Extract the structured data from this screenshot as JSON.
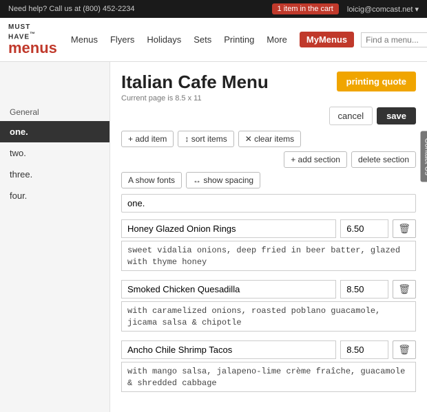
{
  "topbar": {
    "help_text": "Need help? Call us at (800) 452-2234",
    "cart_label": "1 item in the cart",
    "user_email": "loicig@comcast.net ▾"
  },
  "nav": {
    "logo_must_have": "MUST HAVE",
    "logo_tm": "™",
    "logo_menus": "menus",
    "links": [
      "Menus",
      "Flyers",
      "Holidays",
      "Sets",
      "Printing",
      "More"
    ],
    "my_menus": "MyMenus",
    "search_placeholder": "Find a menu..."
  },
  "page": {
    "title": "Italian Cafe Menu",
    "subtitle": "Current page is 8.5 x 11",
    "printing_quote": "printing quote",
    "cancel_label": "cancel",
    "save_label": "save"
  },
  "toolbar": {
    "add_item": "+ add item",
    "sort_items": "↕ sort items",
    "clear_items": "✕ clear items",
    "add_section": "+ add section",
    "delete_section": "delete section",
    "show_fonts": "A show fonts",
    "show_spacing": "↔ show spacing"
  },
  "sidebar": {
    "section_label": "General",
    "items": [
      {
        "label": "one.",
        "active": true
      },
      {
        "label": "two.",
        "active": false
      },
      {
        "label": "three.",
        "active": false
      },
      {
        "label": "four.",
        "active": false
      }
    ]
  },
  "section": {
    "name": "one.",
    "items": [
      {
        "name": "Honey Glazed Onion Rings",
        "price": "6.50",
        "description": "sweet vidalia onions, deep fried in beer batter, glazed with thyme honey"
      },
      {
        "name": "Smoked Chicken Quesadilla",
        "price": "8.50",
        "description": "with caramelized onions, roasted poblano guacamole, jicama salsa & chipotle"
      },
      {
        "name": "Ancho Chile Shrimp Tacos",
        "price": "8.50",
        "description": "with mango salsa, jalapeno-lime crème fraîche, guacamole & shredded cabbage"
      }
    ]
  },
  "contact_tab": "Contact Us"
}
